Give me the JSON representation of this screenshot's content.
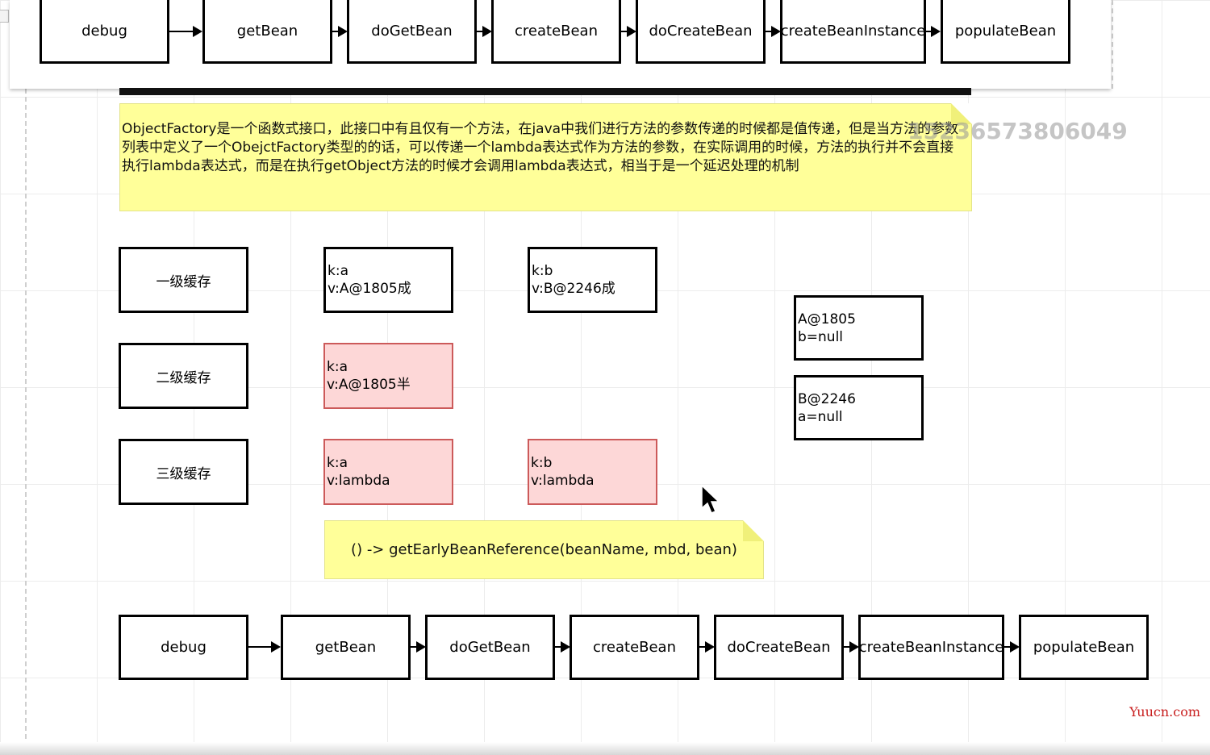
{
  "flow_top": [
    "debug",
    "getBean",
    "doGetBean",
    "createBean",
    "doCreateBean",
    "createBeanInstance",
    "populateBean"
  ],
  "flow_bottom": [
    "debug",
    "getBean",
    "doGetBean",
    "createBean",
    "doCreateBean",
    "createBeanInstance",
    "populateBean"
  ],
  "note_main": "ObjectFactory是一个函数式接口，此接口中有且仅有一个方法，在java中我们进行方法的参数传递的时候都是值传递，但是当方法的参数列表中定义了一个ObejctFactory类型的的话，可以传递一个lambda表达式作为方法的参数，在实际调用的时候，方法的执行并不会直接执行lambda表达式，而是在执行getObject方法的时候才会调用lambda表达式，相当于是一个延迟处理的机制",
  "watermark": "152365738060​49",
  "cache_labels": {
    "level1": "一级缓存",
    "level2": "二级缓存",
    "level3": "三级缓存"
  },
  "cache_entries": {
    "l1_a": "k:a\nv:A@1805成",
    "l1_b": "k:b\nv:B@2246成",
    "l2_a": "k:a\nv:A@1805半",
    "l3_a": "k:a\nv:lambda",
    "l3_b": "k:b\nv:lambda"
  },
  "objects": {
    "a": "A@1805\nb=null",
    "b": "B@2246\na=null"
  },
  "lambda_note": "() -> getEarlyBeanReference(beanName, mbd, bean)",
  "brand": "Yuucn.com",
  "colors": {
    "note_bg": "#ffff99",
    "pink_fill": "#fdd7d7",
    "pink_border": "#cc5a5a",
    "brand": "#c81e1e"
  },
  "icons": [
    "mouse-cursor-icon"
  ]
}
